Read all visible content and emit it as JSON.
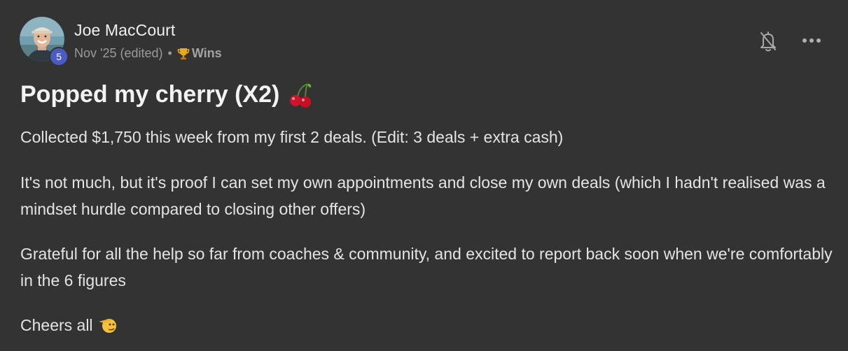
{
  "post": {
    "author": {
      "name": "Joe MacCourt",
      "level": "5"
    },
    "meta": {
      "date": "Nov '25 (edited)",
      "separator": "•",
      "category": "Wins",
      "category_icon": "trophy-icon"
    },
    "actions": {
      "notify_icon": "bell-off-icon",
      "more_icon": "more-horizontal-icon"
    },
    "title": "Popped my cherry (X2)",
    "title_emoji": "cherries-emoji",
    "paragraphs": [
      "Collected $1,750 this week from my first 2 deals. (Edit: 3 deals + extra cash)",
      "It's not much, but it's proof I can set my own appointments and close my own deals (which I hadn't realised was a mindset hurdle compared to closing other offers)",
      "Grateful for all the help so far from coaches & community, and excited to report back soon when we're comfortably in the 6 figures",
      "Cheers all"
    ],
    "closing_emoji": "saluting-face-emoji"
  },
  "colors": {
    "background": "#333333",
    "text": "#e4e4e4",
    "muted": "#9a9a9a",
    "level_badge": "#4a5bc4"
  }
}
